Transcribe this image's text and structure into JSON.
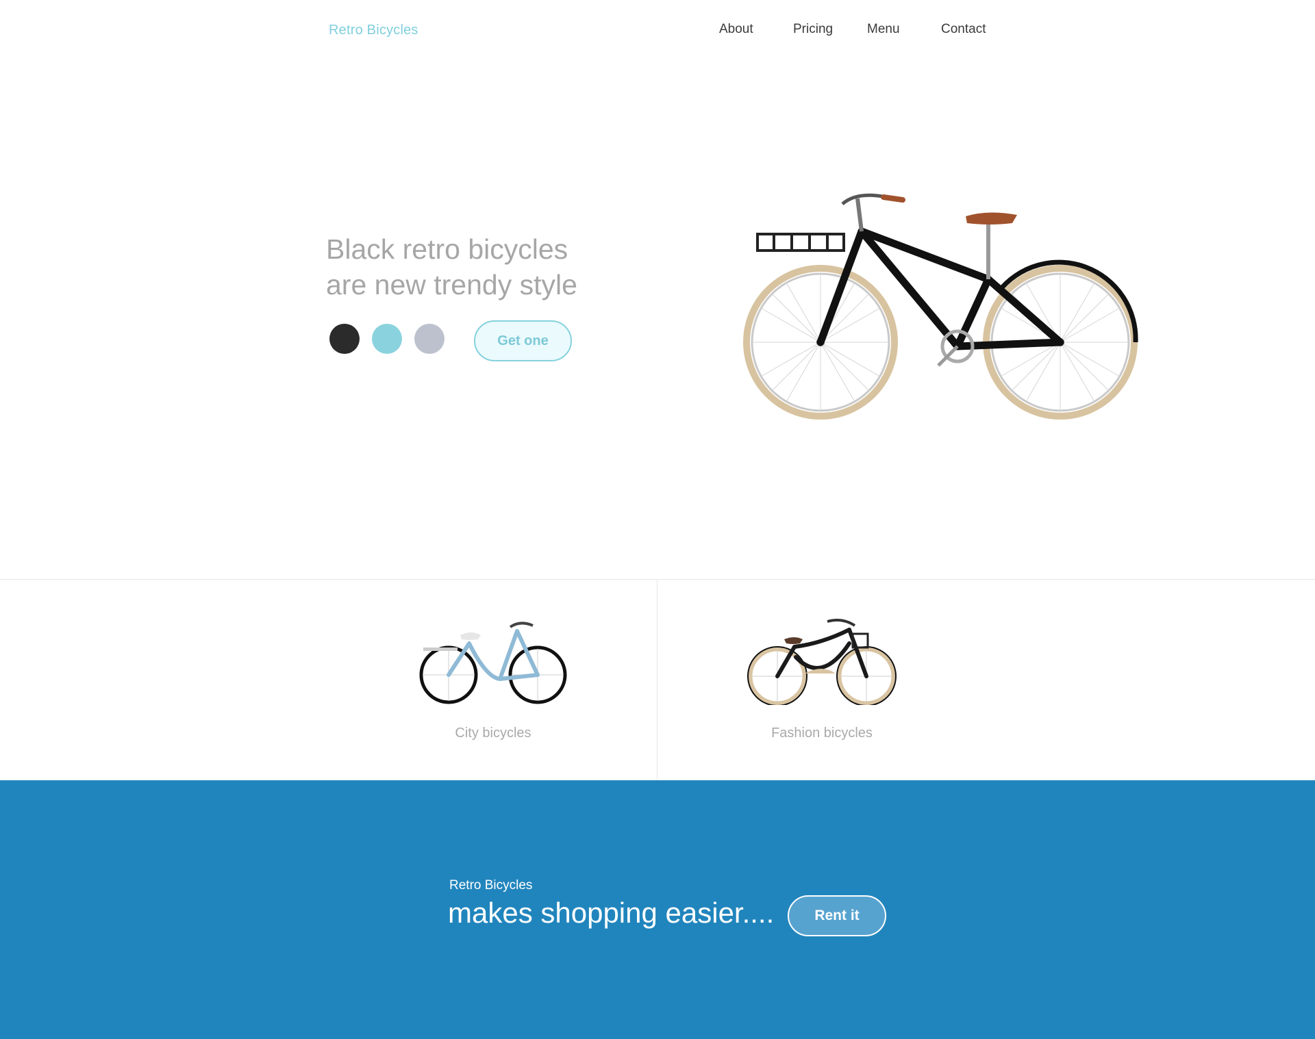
{
  "header": {
    "logo_text": "Retro Bicycles",
    "nav": {
      "about": "About",
      "pricing": "Pricing",
      "menu": "Menu",
      "contact": "Contact"
    }
  },
  "hero": {
    "title_line1": "Black retro bicycles",
    "title_line2": "are new trendy style",
    "color_options": [
      {
        "name": "black",
        "color": "#2b2b2b"
      },
      {
        "name": "teal",
        "color": "#8ad3de"
      },
      {
        "name": "gray",
        "color": "#bcc1cd"
      }
    ],
    "cta_label": "Get one",
    "image_icon": "black-retro-bicycle"
  },
  "categories": [
    {
      "label": "City bicycles",
      "image_icon": "light-blue-city-bicycle"
    },
    {
      "label": "Fashion bicycles",
      "image_icon": "black-cruiser-bicycle-with-basket"
    }
  ],
  "banner": {
    "brand": "Retro Bicycles",
    "tagline": "makes shopping easier....",
    "cta_label": "Rent it"
  },
  "colors": {
    "accent": "#7fcfdc",
    "banner_background": "#2185bd",
    "hero_text": "#a6a6a6"
  }
}
